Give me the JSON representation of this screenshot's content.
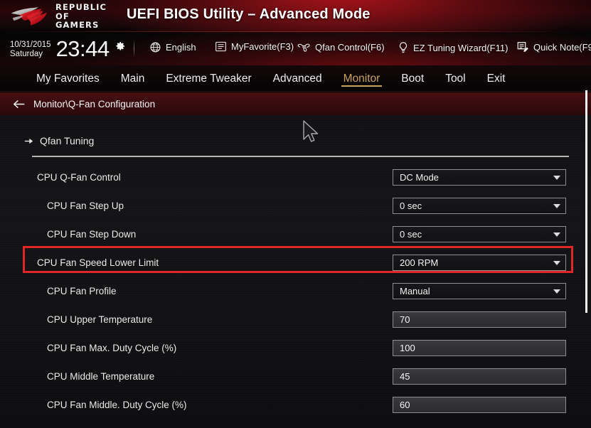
{
  "header": {
    "brand_line1": "REPUBLIC OF",
    "brand_line2": "GAMERS",
    "logo_icon": "rog-eye-logo",
    "title": "UEFI BIOS Utility – Advanced Mode",
    "accent_red": "#b8161e",
    "accent_gold": "#c8a257"
  },
  "infobar": {
    "date": "10/31/2015",
    "weekday": "Saturday",
    "time": "23:44",
    "gear_icon": "gear-icon",
    "tools": [
      {
        "label": "English",
        "icon": "globe-icon"
      },
      {
        "label": "MyFavorite(F3)",
        "icon": "list-icon"
      },
      {
        "label": "Qfan Control(F6)",
        "icon": "fan-icon"
      },
      {
        "label": "EZ Tuning Wizard(F11)",
        "icon": "lightbulb-icon"
      },
      {
        "label": "Quick Note(F9",
        "icon": "note-pencil-icon"
      }
    ]
  },
  "menu": {
    "tabs": [
      {
        "label": "My Favorites",
        "active": false
      },
      {
        "label": "Main",
        "active": false
      },
      {
        "label": "Extreme Tweaker",
        "active": false
      },
      {
        "label": "Advanced",
        "active": false
      },
      {
        "label": "Monitor",
        "active": true
      },
      {
        "label": "Boot",
        "active": false
      },
      {
        "label": "Tool",
        "active": false
      },
      {
        "label": "Exit",
        "active": false
      }
    ]
  },
  "breadcrumb": {
    "back_icon": "back-arrow-icon",
    "path": "Monitor\\Q-Fan Configuration"
  },
  "content": {
    "submenu": {
      "label": "Qfan Tuning",
      "icon": "arrow-right-icon"
    },
    "settings": [
      {
        "label": "CPU Q-Fan Control",
        "indent": 1,
        "type": "dropdown",
        "value": "DC Mode"
      },
      {
        "label": "CPU Fan Step Up",
        "indent": 2,
        "type": "dropdown",
        "value": "0 sec"
      },
      {
        "label": "CPU Fan Step Down",
        "indent": 2,
        "type": "dropdown",
        "value": "0 sec"
      },
      {
        "label": "CPU Fan Speed Lower Limit",
        "indent": 1,
        "type": "dropdown",
        "value": "200 RPM"
      },
      {
        "label": "CPU Fan Profile",
        "indent": 2,
        "type": "dropdown",
        "value": "Manual"
      },
      {
        "label": "CPU Upper Temperature",
        "indent": 2,
        "type": "textfield",
        "value": "70"
      },
      {
        "label": "CPU Fan Max. Duty Cycle (%)",
        "indent": 2,
        "type": "textfield",
        "value": "100"
      },
      {
        "label": "CPU Middle Temperature",
        "indent": 2,
        "type": "textfield",
        "value": "45"
      },
      {
        "label": "CPU Fan Middle. Duty Cycle (%)",
        "indent": 2,
        "type": "textfield",
        "value": "60"
      }
    ]
  },
  "annotation": {
    "highlight_color": "#e02626",
    "highlighted_setting": "CPU Fan Speed Lower Limit"
  },
  "cursor": {
    "icon": "mouse-pointer-icon"
  }
}
